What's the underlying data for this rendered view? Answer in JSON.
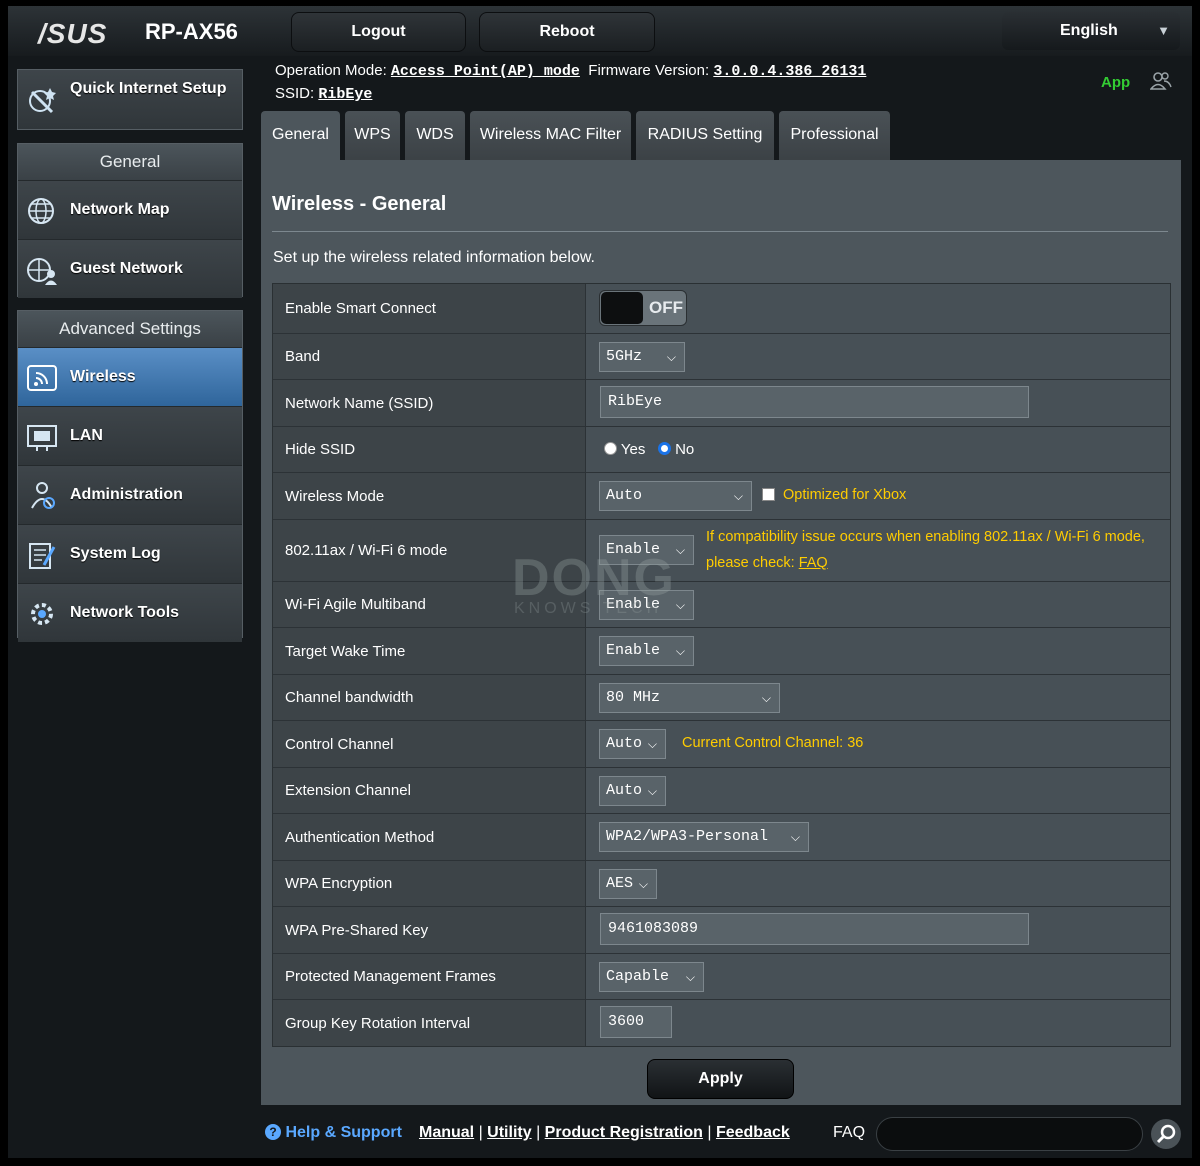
{
  "header": {
    "brand": "/SUS",
    "model": "RP-AX56",
    "logout_label": "Logout",
    "reboot_label": "Reboot",
    "language": "English"
  },
  "info": {
    "op_mode_label": "Operation Mode:",
    "op_mode_value": "Access Point(AP) mode",
    "fw_label": "Firmware Version:",
    "fw_value": "3.0.0.4.386_26131",
    "ssid_label": "SSID:",
    "ssid_value": "RibEye",
    "app_label": "App"
  },
  "sidebar": {
    "quick_setup": "Quick Internet Setup",
    "general_header": "General",
    "general_items": [
      {
        "label": "Network Map",
        "icon": "globe-network-icon"
      },
      {
        "label": "Guest Network",
        "icon": "guest-network-icon"
      }
    ],
    "advanced_header": "Advanced Settings",
    "advanced_items": [
      {
        "label": "Wireless",
        "icon": "wireless-icon"
      },
      {
        "label": "LAN",
        "icon": "lan-icon"
      },
      {
        "label": "Administration",
        "icon": "administration-icon"
      },
      {
        "label": "System Log",
        "icon": "system-log-icon"
      },
      {
        "label": "Network Tools",
        "icon": "network-tools-icon"
      }
    ]
  },
  "tabs": [
    "General",
    "WPS",
    "WDS",
    "Wireless MAC Filter",
    "RADIUS Setting",
    "Professional"
  ],
  "page": {
    "title": "Wireless - General",
    "description": "Set up the wireless related information below."
  },
  "settings": {
    "smart_connect": {
      "label": "Enable Smart Connect",
      "value": "OFF"
    },
    "band": {
      "label": "Band",
      "value": "5GHz"
    },
    "ssid": {
      "label": "Network Name (SSID)",
      "value": "RibEye"
    },
    "hide_ssid": {
      "label": "Hide SSID",
      "yes": "Yes",
      "no": "No",
      "selected": "No"
    },
    "wireless_mode": {
      "label": "Wireless Mode",
      "value": "Auto",
      "xbox_label": "Optimized for Xbox"
    },
    "wifi6": {
      "label": "802.11ax / Wi-Fi 6 mode",
      "value": "Enable",
      "note1": "If compatibility issue occurs when enabling 802.11ax / Wi-Fi 6 mode,",
      "note2": "please check:",
      "faq": "FAQ"
    },
    "agile": {
      "label": "Wi-Fi Agile Multiband",
      "value": "Enable"
    },
    "twt": {
      "label": "Target Wake Time",
      "value": "Enable"
    },
    "bandwidth": {
      "label": "Channel bandwidth",
      "value": "80 MHz"
    },
    "control_channel": {
      "label": "Control Channel",
      "value": "Auto",
      "note": "Current Control Channel: 36"
    },
    "ext_channel": {
      "label": "Extension Channel",
      "value": "Auto"
    },
    "auth": {
      "label": "Authentication Method",
      "value": "WPA2/WPA3-Personal"
    },
    "encryption": {
      "label": "WPA Encryption",
      "value": "AES"
    },
    "psk": {
      "label": "WPA Pre-Shared Key",
      "value": "9461083089"
    },
    "pmf": {
      "label": "Protected Management Frames",
      "value": "Capable"
    },
    "gkri": {
      "label": "Group Key Rotation Interval",
      "value": "3600"
    }
  },
  "apply_label": "Apply",
  "footer": {
    "help": "Help & Support",
    "manual": "Manual",
    "utility": "Utility",
    "registration": "Product Registration",
    "feedback": "Feedback",
    "faq": "FAQ"
  },
  "watermark": {
    "big": "DONG",
    "small": "KNOWS TECH"
  }
}
